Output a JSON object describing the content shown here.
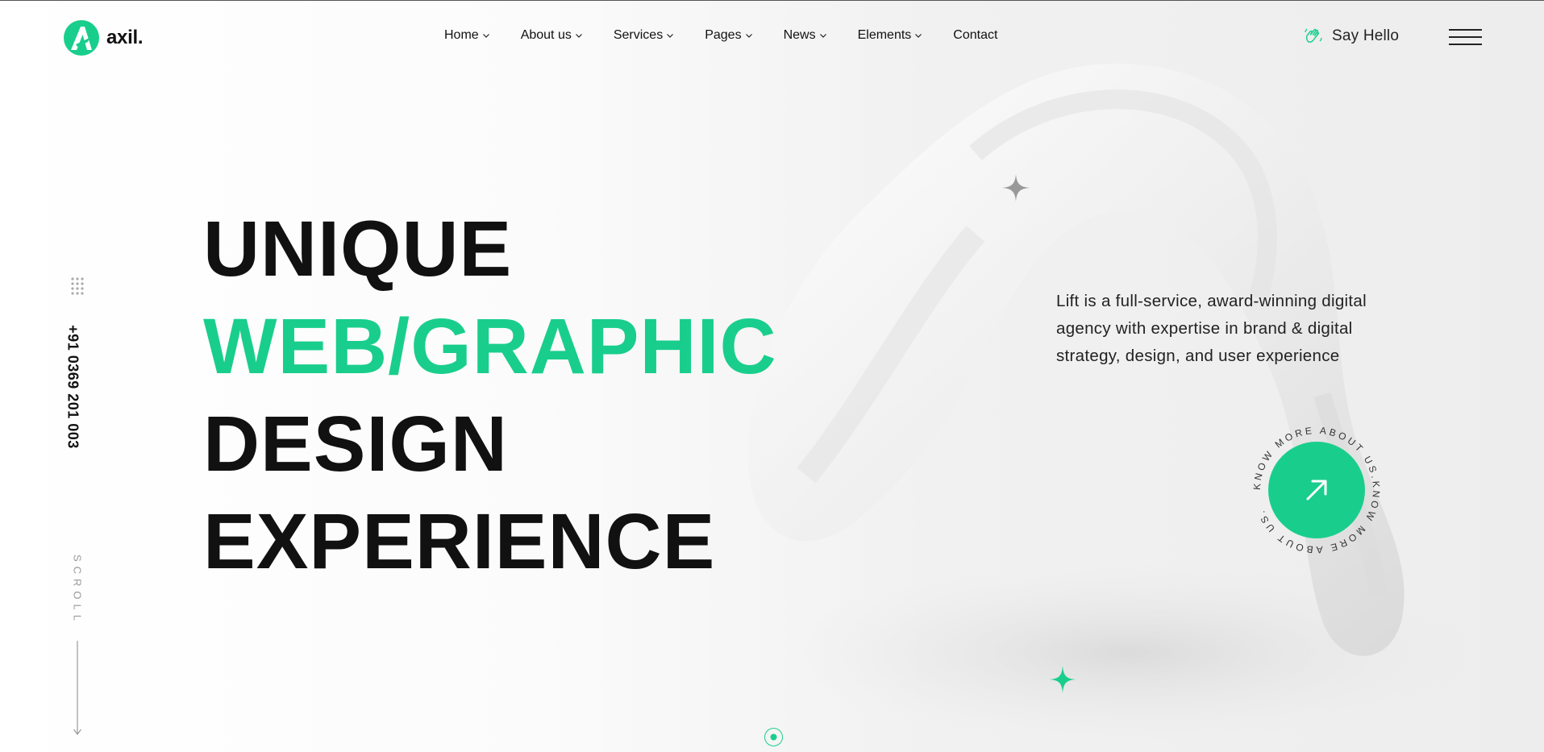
{
  "brand": {
    "name": "axil.",
    "accent": "#19ce8c"
  },
  "nav": {
    "items": [
      {
        "label": "Home",
        "has_dropdown": true
      },
      {
        "label": "About us",
        "has_dropdown": true
      },
      {
        "label": "Services",
        "has_dropdown": true
      },
      {
        "label": "Pages",
        "has_dropdown": true
      },
      {
        "label": "News",
        "has_dropdown": true
      },
      {
        "label": "Elements",
        "has_dropdown": true
      },
      {
        "label": "Contact",
        "has_dropdown": false
      }
    ]
  },
  "header": {
    "say_hello": "Say Hello",
    "hello_icon": "waving-hand-icon",
    "menu_icon": "hamburger-icon"
  },
  "rail": {
    "phone": "+91 0369 201 003",
    "scroll": "SCROLL",
    "grid_icon": "dots-grid-icon",
    "arrow_icon": "arrow-down-icon"
  },
  "hero": {
    "line1": "UNIQUE",
    "line2": "WEB/GRAPHIC",
    "line3": "DESIGN",
    "line4": "EXPERIENCE",
    "description": "Lift is a full-service, award-winning digital agency with expertise in brand & digital strategy, design, and user experience",
    "badge_ring_text": "KNOW MORE ABOUT US.KNOW MORE ABOUT US.",
    "badge_icon": "arrow-up-right-icon"
  },
  "colors": {
    "text": "#111111",
    "accent": "#19ce8c",
    "muted": "#999999"
  }
}
